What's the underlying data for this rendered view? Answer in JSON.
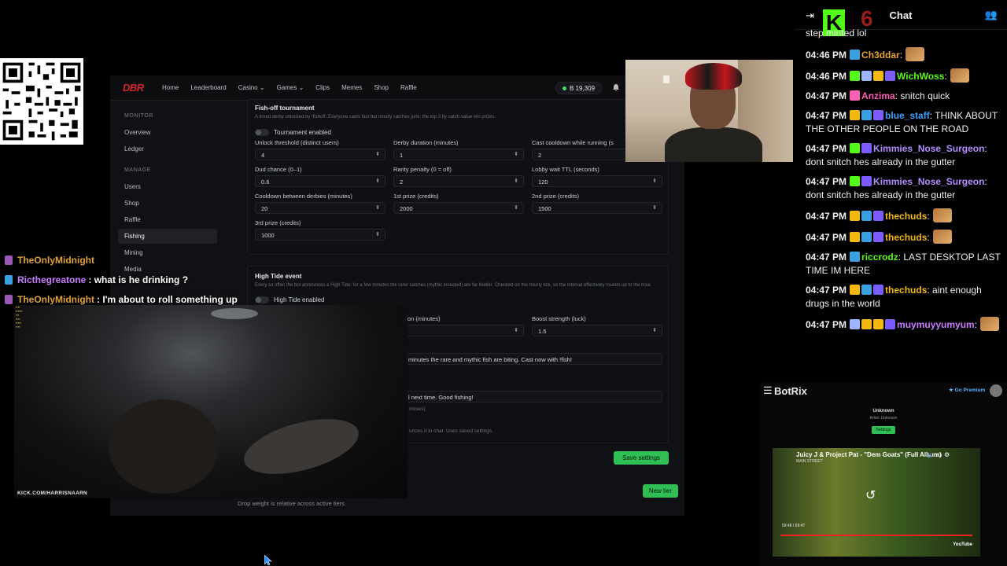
{
  "dashboard": {
    "logo": "DBR",
    "nav": [
      "Home",
      "Leaderboard",
      "Casino",
      "Games",
      "Clips",
      "Memes",
      "Shop",
      "Raffle"
    ],
    "balance": "B 19,309",
    "sidebar": {
      "monitor_label": "MONITOR",
      "monitor_items": [
        "Overview",
        "Ledger"
      ],
      "manage_label": "MANAGE",
      "manage_items": [
        "Users",
        "Shop",
        "Raffle",
        "Fishing",
        "Mining",
        "Media"
      ]
    },
    "fishoff": {
      "title": "Fish-off tournament",
      "desc": "A timed derby unlocked by !fishoff. Everyone casts fast but mostly catches junk; the top 3 by catch value win prizes.",
      "toggle_label": "Tournament enabled",
      "fields": [
        {
          "label": "Unlock threshold (distinct users)",
          "value": "4"
        },
        {
          "label": "Derby duration (minutes)",
          "value": "1"
        },
        {
          "label": "Cast cooldown while running (s",
          "value": "2"
        },
        {
          "label": "Dud chance (0–1)",
          "value": "0.6"
        },
        {
          "label": "Rarity penalty (0 = off)",
          "value": "2"
        },
        {
          "label": "Lobby wait TTL (seconds)",
          "value": "120"
        },
        {
          "label": "Cooldown between derbies (minutes)",
          "value": "20"
        },
        {
          "label": "1st prize (credits)",
          "value": "2000"
        },
        {
          "label": "2nd prize (credits)",
          "value": "1500"
        },
        {
          "label": "3rd prize (credits)",
          "value": "1000"
        }
      ]
    },
    "hightide": {
      "title": "High Tide event",
      "desc": "Every so often the bot announces a High Tide: for a few minutes the rarer catches (mythic included) are far likelier. Checked on the hourly tick, so the interval effectively rounds up to the hour.",
      "toggle_label": "High Tide enabled",
      "duration_label": "ation (minutes)",
      "boost_label": "Boost strength (luck)",
      "boost_value": "1.5",
      "announce_text": "minutes the rare and mythic fish are biting. Cast now with !fish!",
      "end_text": "l next time. Good fishing!",
      "end_note": "closes).",
      "test_note": "unces it in chat. Uses saved settings."
    },
    "save_button": "Save settings",
    "new_tier_button": "New tier",
    "drop_note": "Drop weight is relative across active tiers."
  },
  "overlay_chat": [
    {
      "name": "TheOnlyMidnight",
      "text": "",
      "color": "#e0a23a",
      "badge_color": "#9b59b6"
    },
    {
      "name": "Ricthegreatone",
      "text": ": what is he drinking ?",
      "color": "#c77dff",
      "badge_color": "#3aa0e0"
    },
    {
      "name": "TheOnlyMidnight",
      "text": ": I'm about to roll something up",
      "color": "#e0a23a",
      "badge_color": "#9b59b6"
    }
  ],
  "game_capture": {
    "url_text": "KICK.COM/HARRISNAARN"
  },
  "chat": {
    "title": "Chat",
    "sixnum": "6",
    "first_line": "step minted lol",
    "messages": [
      {
        "time": "04:46 PM",
        "user": "Ch3ddar",
        "color": "#e8a33a",
        "text": ":",
        "badges": [
          "#3aa0e0"
        ]
      },
      {
        "time": "04:46 PM",
        "user": "WichWoss",
        "color": "#53fc18",
        "text": ":",
        "badges": [
          "#53fc18",
          "#9db4ff",
          "#f2b90f",
          "#7b5cff"
        ]
      },
      {
        "time": "04:47 PM",
        "user": "Anzima",
        "color": "#ff5fb4",
        "text": ": snitch quick",
        "badges": [
          "#ff5fb4"
        ]
      },
      {
        "time": "04:47 PM",
        "user": "blue_staff",
        "color": "#3aa0ff",
        "text": ": THINK ABOUT THE OTHER PEOPLE ON THE ROAD",
        "badges": [
          "#f2b90f",
          "#3aa0e0",
          "#7b5cff"
        ]
      },
      {
        "time": "04:47 PM",
        "user": "Kimmies_Nose_Surgeon",
        "color": "#b48cff",
        "text": ": dont snitch hes already in the gutter",
        "badges": [
          "#53fc18",
          "#7b5cff"
        ]
      },
      {
        "time": "04:47 PM",
        "user": "Kimmies_Nose_Surgeon",
        "color": "#b48cff",
        "text": ": dont snitch hes already in the gutter",
        "badges": [
          "#53fc18",
          "#7b5cff"
        ]
      },
      {
        "time": "04:47 PM",
        "user": "thechuds",
        "color": "#f2b90f",
        "text": ":",
        "badges": [
          "#f2b90f",
          "#3aa0e0",
          "#7b5cff"
        ]
      },
      {
        "time": "04:47 PM",
        "user": "thechuds",
        "color": "#f2b90f",
        "text": ":",
        "badges": [
          "#f2b90f",
          "#3aa0e0",
          "#7b5cff"
        ]
      },
      {
        "time": "04:47 PM",
        "user": "riccrodz",
        "color": "#53fc18",
        "text": ": LAST DESKTOP LAST TIME IM HERE",
        "badges": [
          "#3aa0e0"
        ]
      },
      {
        "time": "04:47 PM",
        "user": "thechuds",
        "color": "#f2b90f",
        "text": ": aint enough drugs in the world",
        "badges": [
          "#f2b90f",
          "#3aa0e0",
          "#7b5cff"
        ]
      },
      {
        "time": "04:47 PM",
        "user": "muymuyyumyum",
        "color": "#c77dff",
        "text": ":",
        "badges": [
          "#9db4ff",
          "#f2b90f",
          "#f2b90f",
          "#7b5cff"
        ]
      }
    ]
  },
  "botrix": {
    "brand": "BotRix",
    "premium": "★ Go Premium",
    "status": "Unknown",
    "artist_line": "Artist: Unknown",
    "settings_button": "Settings",
    "video_title": "Juicy J & Project Pat - \"Dem Goats\" (Full Album)",
    "video_sub": "MAIN STREET",
    "time": "59:46 / 59:47",
    "youtube": "YouTube"
  }
}
